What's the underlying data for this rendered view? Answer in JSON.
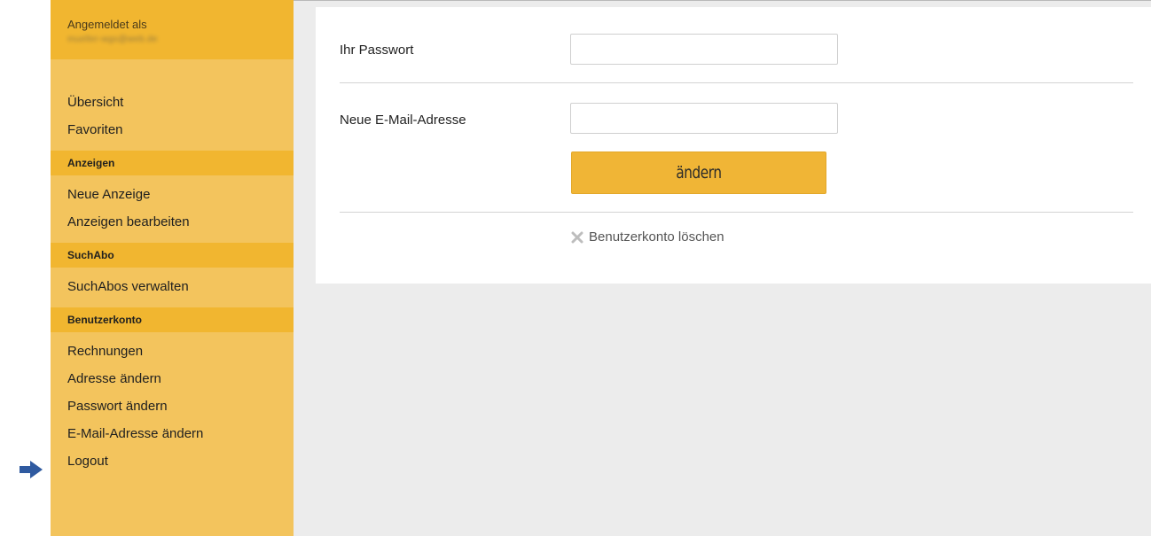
{
  "sidebar": {
    "login_label": "Angemeldet als",
    "login_email": "mueller-wgs@web.de",
    "groups": [
      {
        "items": [
          "Übersicht",
          "Favoriten"
        ]
      },
      {
        "header": "Anzeigen",
        "items": [
          "Neue Anzeige",
          "Anzeigen bearbeiten"
        ]
      },
      {
        "header": "SuchAbo",
        "items": [
          "SuchAbos verwalten"
        ]
      },
      {
        "header": "Benutzerkonto",
        "items": [
          "Rechnungen",
          "Adresse ändern",
          "Passwort ändern",
          "E-Mail-Adresse ändern",
          "Logout"
        ]
      }
    ]
  },
  "form": {
    "password_label": "Ihr Passwort",
    "password_value": "",
    "email_label": "Neue E-Mail-Adresse",
    "email_value": "",
    "submit_label": "ändern",
    "delete_label": "Benutzerkonto löschen"
  },
  "colors": {
    "sidebar_bg": "#f3c45d",
    "sidebar_header_bg": "#f1b630",
    "button_bg": "#f0b536",
    "pointer_arrow": "#2f5aa0"
  },
  "icons": {
    "pointer": "right-arrow-icon",
    "delete": "x-icon"
  }
}
